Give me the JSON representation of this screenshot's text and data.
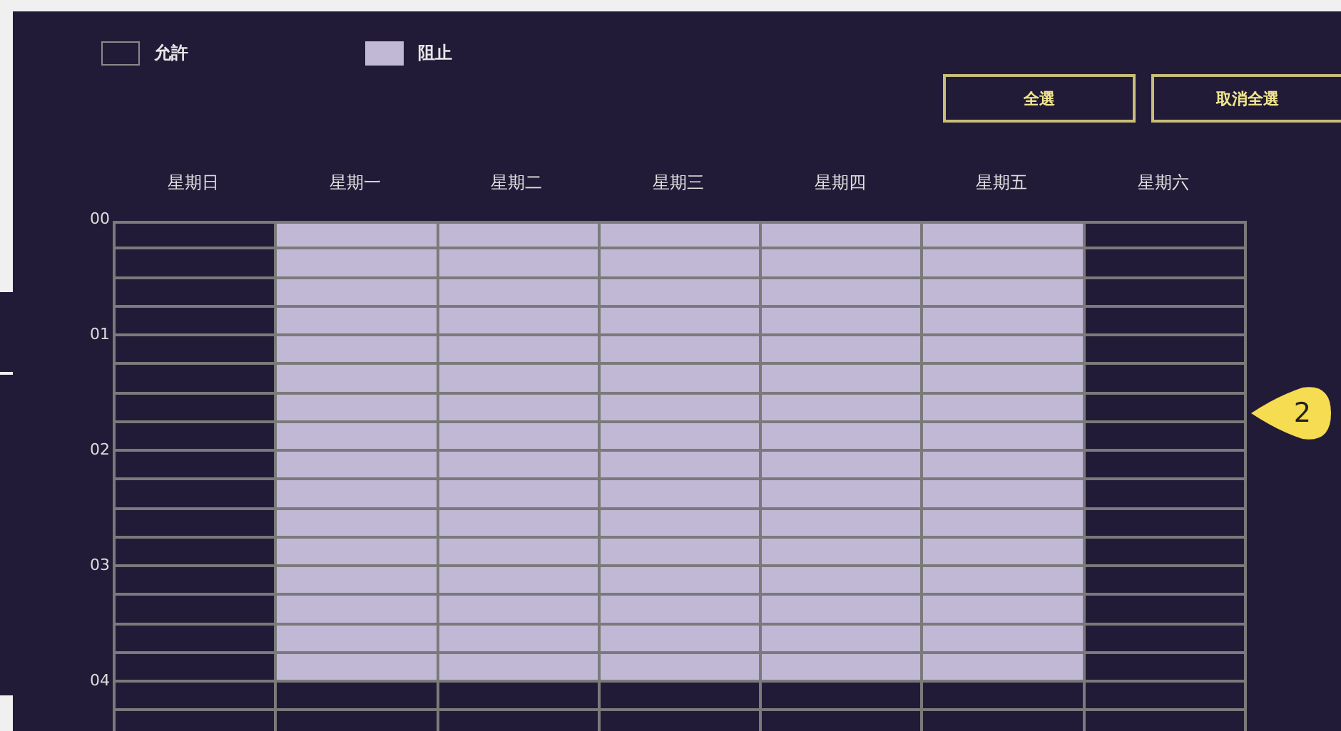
{
  "legend": [
    {
      "label": "允許",
      "kind": "allow"
    },
    {
      "label": "阻止",
      "kind": "block"
    }
  ],
  "buttons": [
    "全選",
    "取消全選"
  ],
  "days": [
    "星期日",
    "星期一",
    "星期二",
    "星期三",
    "星期四",
    "星期五",
    "星期六"
  ],
  "rows": [
    {
      "hour": "00",
      "cells": [
        {
          "blocked": false
        },
        {
          "blocked": true
        },
        {
          "blocked": true
        },
        {
          "blocked": true
        },
        {
          "blocked": true
        },
        {
          "blocked": true
        },
        {
          "blocked": false
        }
      ]
    },
    {
      "cells": [
        {
          "blocked": false
        },
        {
          "blocked": true
        },
        {
          "blocked": true
        },
        {
          "blocked": true
        },
        {
          "blocked": true
        },
        {
          "blocked": true
        },
        {
          "blocked": false
        }
      ]
    },
    {
      "cells": [
        {
          "blocked": false
        },
        {
          "blocked": true
        },
        {
          "blocked": true
        },
        {
          "blocked": true
        },
        {
          "blocked": true
        },
        {
          "blocked": true
        },
        {
          "blocked": false
        }
      ]
    },
    {
      "cells": [
        {
          "blocked": false
        },
        {
          "blocked": true
        },
        {
          "blocked": true
        },
        {
          "blocked": true
        },
        {
          "blocked": true
        },
        {
          "blocked": true
        },
        {
          "blocked": false
        }
      ]
    },
    {
      "hour": "01",
      "cells": [
        {
          "blocked": false
        },
        {
          "blocked": true
        },
        {
          "blocked": true
        },
        {
          "blocked": true
        },
        {
          "blocked": true
        },
        {
          "blocked": true
        },
        {
          "blocked": false
        }
      ]
    },
    {
      "cells": [
        {
          "blocked": false
        },
        {
          "blocked": true
        },
        {
          "blocked": true
        },
        {
          "blocked": true
        },
        {
          "blocked": true
        },
        {
          "blocked": true
        },
        {
          "blocked": false
        }
      ]
    },
    {
      "cells": [
        {
          "blocked": false
        },
        {
          "blocked": true
        },
        {
          "blocked": true
        },
        {
          "blocked": true
        },
        {
          "blocked": true
        },
        {
          "blocked": true
        },
        {
          "blocked": false
        }
      ]
    },
    {
      "cells": [
        {
          "blocked": false
        },
        {
          "blocked": true
        },
        {
          "blocked": true
        },
        {
          "blocked": true
        },
        {
          "blocked": true
        },
        {
          "blocked": true
        },
        {
          "blocked": false
        }
      ]
    },
    {
      "hour": "02",
      "cells": [
        {
          "blocked": false
        },
        {
          "blocked": true
        },
        {
          "blocked": true
        },
        {
          "blocked": true
        },
        {
          "blocked": true
        },
        {
          "blocked": true
        },
        {
          "blocked": false
        }
      ]
    },
    {
      "cells": [
        {
          "blocked": false
        },
        {
          "blocked": true
        },
        {
          "blocked": true
        },
        {
          "blocked": true
        },
        {
          "blocked": true
        },
        {
          "blocked": true
        },
        {
          "blocked": false
        }
      ]
    },
    {
      "cells": [
        {
          "blocked": false
        },
        {
          "blocked": true
        },
        {
          "blocked": true
        },
        {
          "blocked": true
        },
        {
          "blocked": true
        },
        {
          "blocked": true
        },
        {
          "blocked": false
        }
      ]
    },
    {
      "cells": [
        {
          "blocked": false
        },
        {
          "blocked": true
        },
        {
          "blocked": true
        },
        {
          "blocked": true
        },
        {
          "blocked": true
        },
        {
          "blocked": true
        },
        {
          "blocked": false
        }
      ]
    },
    {
      "hour": "03",
      "cells": [
        {
          "blocked": false
        },
        {
          "blocked": true
        },
        {
          "blocked": true
        },
        {
          "blocked": true
        },
        {
          "blocked": true
        },
        {
          "blocked": true
        },
        {
          "blocked": false
        }
      ]
    },
    {
      "cells": [
        {
          "blocked": false
        },
        {
          "blocked": true
        },
        {
          "blocked": true
        },
        {
          "blocked": true
        },
        {
          "blocked": true
        },
        {
          "blocked": true
        },
        {
          "blocked": false
        }
      ]
    },
    {
      "cells": [
        {
          "blocked": false
        },
        {
          "blocked": true
        },
        {
          "blocked": true
        },
        {
          "blocked": true
        },
        {
          "blocked": true
        },
        {
          "blocked": true
        },
        {
          "blocked": false
        }
      ]
    },
    {
      "cells": [
        {
          "blocked": false
        },
        {
          "blocked": true
        },
        {
          "blocked": true
        },
        {
          "blocked": true
        },
        {
          "blocked": true
        },
        {
          "blocked": true
        },
        {
          "blocked": false
        }
      ]
    },
    {
      "hour": "04",
      "cells": [
        {
          "blocked": false
        },
        {
          "blocked": false
        },
        {
          "blocked": false
        },
        {
          "blocked": false
        },
        {
          "blocked": false
        },
        {
          "blocked": false
        },
        {
          "blocked": false
        }
      ]
    },
    {
      "cells": [
        {
          "blocked": false
        },
        {
          "blocked": false
        },
        {
          "blocked": false
        },
        {
          "blocked": false
        },
        {
          "blocked": false
        },
        {
          "blocked": false
        },
        {
          "blocked": false
        }
      ]
    }
  ],
  "callout": {
    "text": "2"
  }
}
